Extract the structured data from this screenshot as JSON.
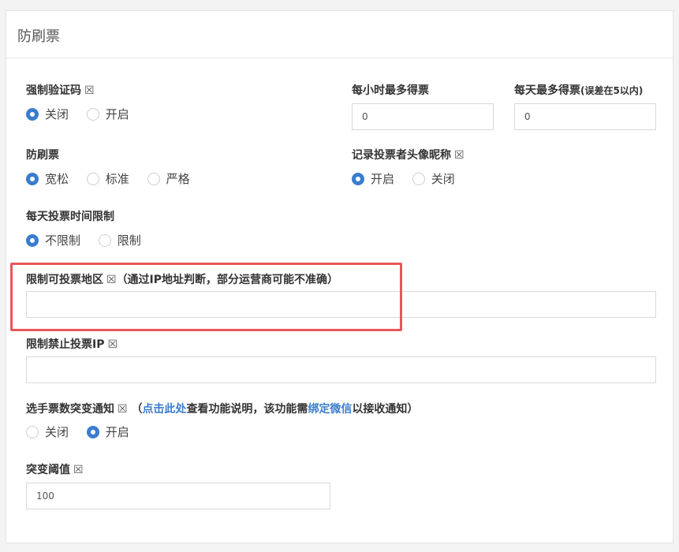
{
  "panel": {
    "title": "防刷票"
  },
  "captcha": {
    "label": "强制验证码",
    "help_icon": "help-icon",
    "options": [
      "关闭",
      "开启"
    ],
    "selected": 0
  },
  "hourly_max": {
    "label": "每小时最多得票",
    "value": "0"
  },
  "daily_max": {
    "label": "每天最多得票",
    "note": "(误差在5以内)",
    "value": "0"
  },
  "antiflood": {
    "label": "防刷票",
    "options": [
      "宽松",
      "标准",
      "严格"
    ],
    "selected": 0
  },
  "record_avatar": {
    "label": "记录投票者头像昵称",
    "options": [
      "开启",
      "关闭"
    ],
    "selected": 0
  },
  "daily_time": {
    "label": "每天投票时间限制",
    "options": [
      "不限制",
      "限制"
    ],
    "selected": 0
  },
  "region": {
    "label": "限制可投票地区",
    "note": "（通过IP地址判断，部分运营商可能不准确）",
    "value": ""
  },
  "banned_ip": {
    "label": "限制禁止投票IP",
    "value": ""
  },
  "notify": {
    "label": "选手票数突变通知",
    "note_prefix": "（",
    "link1": "点击此处",
    "middle": "查看功能说明，该功能需",
    "link2": "绑定微信",
    "suffix": "以接收通知）",
    "options": [
      "关闭",
      "开启"
    ],
    "selected": 1
  },
  "threshold": {
    "label": "突变阈值",
    "value": "100"
  },
  "help_glyph": "☒"
}
